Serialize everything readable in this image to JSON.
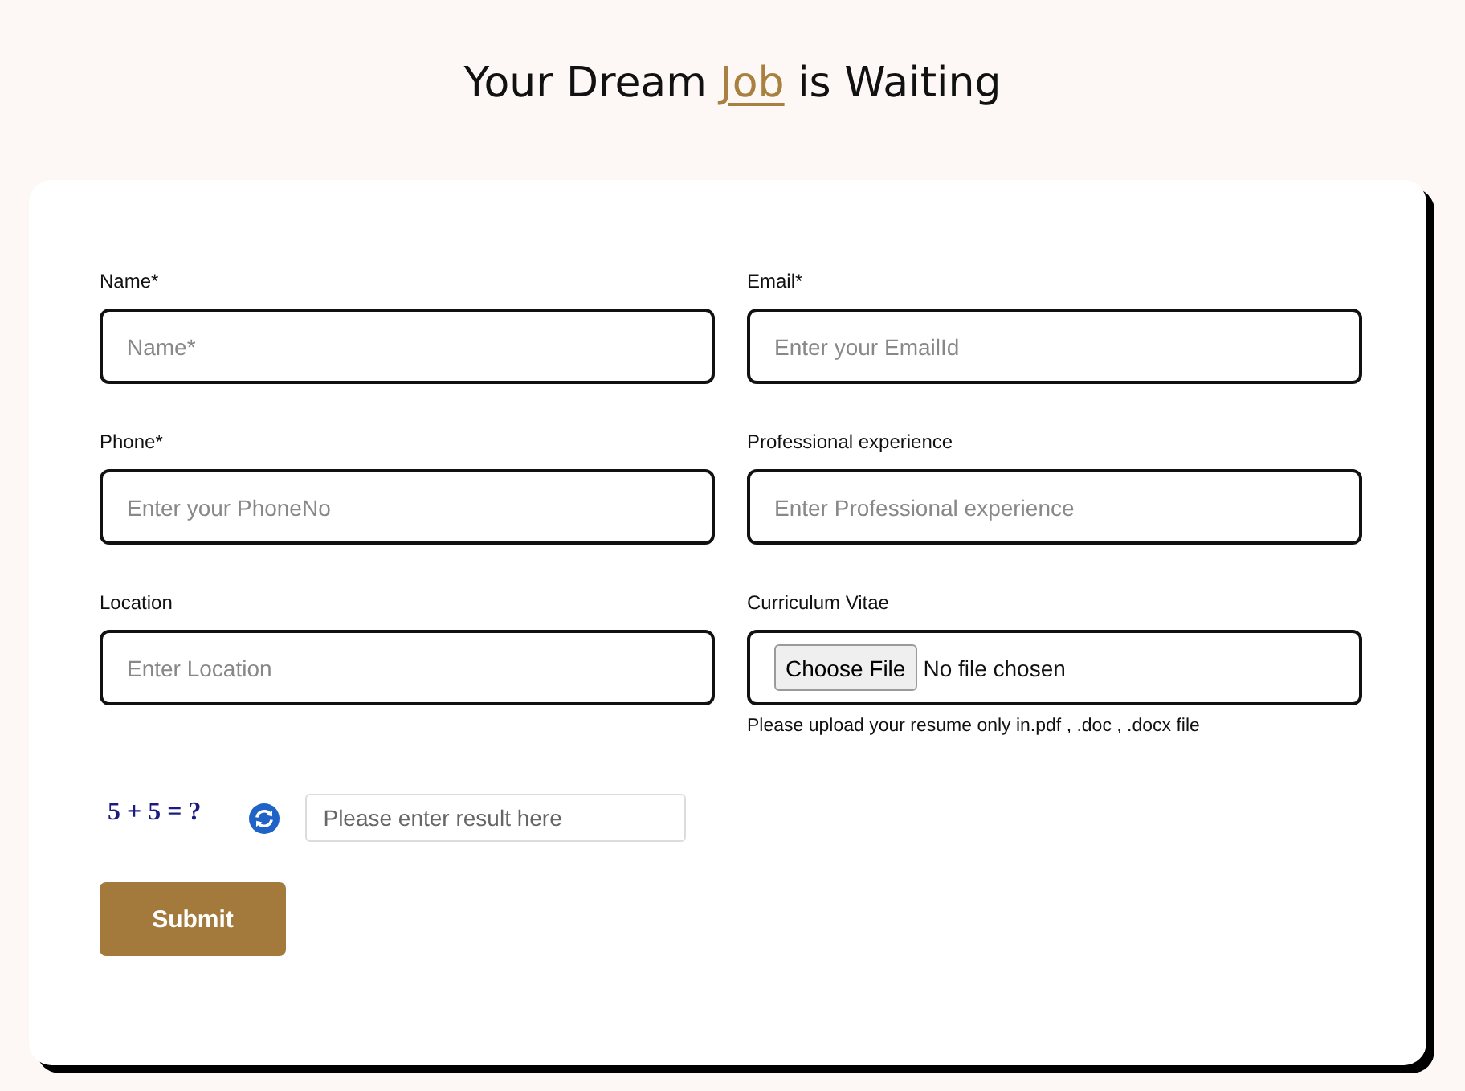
{
  "title": {
    "before": "Your Dream",
    "accent": "Job",
    "after": "is Waiting"
  },
  "fields": [
    {
      "kind": "text",
      "label": "Name*",
      "placeholder": "Name*"
    },
    {
      "kind": "text",
      "label": "Email*",
      "placeholder": "Enter your EmailId"
    },
    {
      "kind": "text",
      "label": "Phone*",
      "placeholder": "Enter your PhoneNo"
    },
    {
      "kind": "text",
      "label": "Professional experience",
      "placeholder": "Enter Professional experience"
    },
    {
      "kind": "text",
      "label": "Location",
      "placeholder": "Enter Location"
    },
    {
      "kind": "file",
      "label": "Curriculum Vitae",
      "button": "Choose File",
      "status": "No file chosen",
      "hint": "Please upload your resume only in.pdf , .doc , .docx file"
    }
  ],
  "captcha": {
    "question": "5 + 5 = ?",
    "placeholder": "Please enter result here"
  },
  "submit": {
    "label": "Submit"
  }
}
